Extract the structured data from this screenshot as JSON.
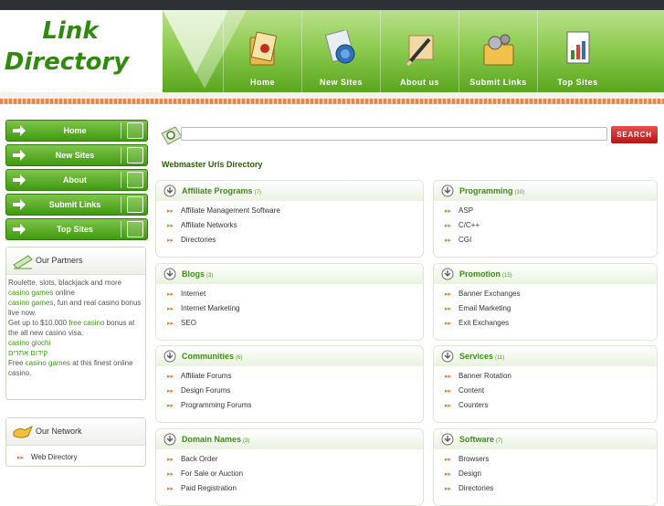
{
  "logo": {
    "line1": "Link",
    "line2": "Directory"
  },
  "nav": [
    {
      "label": "Home",
      "icon": "home-folder-icon"
    },
    {
      "label": "New Sites",
      "icon": "new-sites-globe-icon"
    },
    {
      "label": "About us",
      "icon": "about-pencil-icon"
    },
    {
      "label": "Submit Links",
      "icon": "submit-gears-folder-icon"
    },
    {
      "label": "Top Sites",
      "icon": "top-sites-chart-icon"
    }
  ],
  "left_menu": [
    {
      "label": "Home"
    },
    {
      "label": "New Sites"
    },
    {
      "label": "About"
    },
    {
      "label": "Submit Links"
    },
    {
      "label": "Top Sites"
    }
  ],
  "partners": {
    "title": "Our Partners",
    "lines": [
      {
        "pre": "Roulette, slots, blackjack and more ",
        "link": "casino games",
        "post": " online"
      },
      {
        "pre": "",
        "link": "casino games",
        "post": ", fun and real casino bonus live now."
      },
      {
        "pre": "Get up to $10.000 ",
        "link": "free casino",
        "post": " bonus at the all new casino visa."
      },
      {
        "pre": "",
        "link": "casino giochi",
        "post": ""
      },
      {
        "pre": "",
        "link": "קידום אתרים",
        "post": ""
      },
      {
        "pre": "Free ",
        "link": "casino games",
        "post": " at this finest online casino."
      }
    ]
  },
  "network": {
    "title": "Our Network",
    "items": [
      "Web Directory"
    ]
  },
  "search": {
    "placeholder": "",
    "button": "SEARCH"
  },
  "directory_title": "Webmaster Urls Directory",
  "categories": [
    {
      "name": "Affiliate Programs",
      "count": "(7)",
      "items": [
        "Affiliate Management Software",
        "Affiliate Networks",
        "Directories"
      ]
    },
    {
      "name": "Programming",
      "count": "(10)",
      "items": [
        "ASP",
        "C/C++",
        "CGI"
      ]
    },
    {
      "name": "Blogs",
      "count": "(3)",
      "items": [
        "Internet",
        "Internet Marketing",
        "SEO"
      ]
    },
    {
      "name": "Promotion",
      "count": "(15)",
      "items": [
        "Banner Exchanges",
        "Email Marketing",
        "Exit Exchanges"
      ]
    },
    {
      "name": "Communities",
      "count": "(6)",
      "items": [
        "Affiliate Forums",
        "Design Forums",
        "Programming Forums"
      ]
    },
    {
      "name": "Services",
      "count": "(11)",
      "items": [
        "Banner Rotation",
        "Content",
        "Counters"
      ]
    },
    {
      "name": "Domain Names",
      "count": "(3)",
      "items": [
        "Back Order",
        "For Sale or Auction",
        "Paid Registration"
      ]
    },
    {
      "name": "Software",
      "count": "(7)",
      "items": [
        "Browsers",
        "Design",
        "Directories"
      ]
    }
  ],
  "colors": {
    "accent_green": "#3d8c12",
    "search_red": "#c41e1e",
    "separator_orange": "#e8864a"
  }
}
